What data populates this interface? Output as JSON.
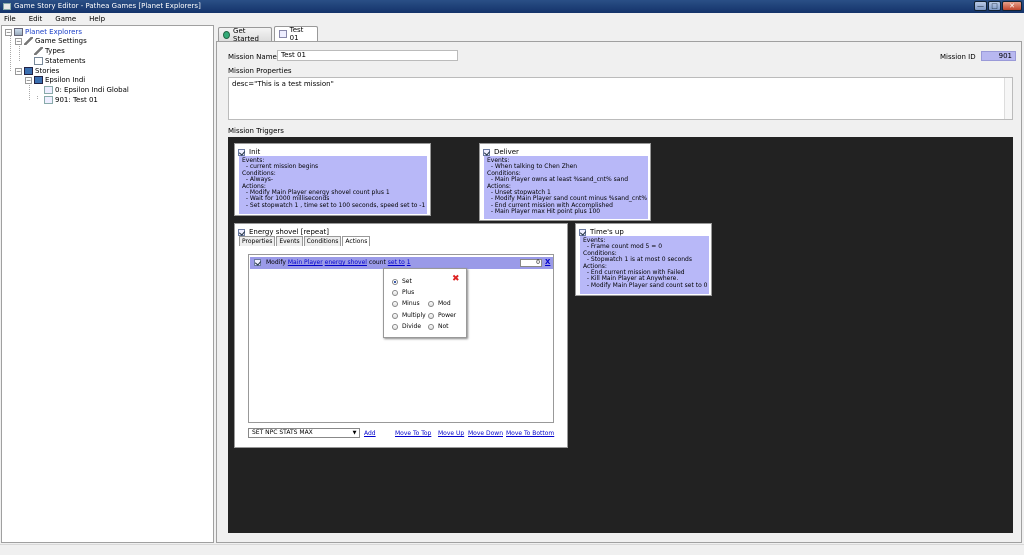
{
  "window": {
    "title": "Game Story Editor - Pathea Games  [Planet Explorers]",
    "min": "—",
    "max": "□",
    "close": "✕"
  },
  "menu": [
    "File",
    "Edit",
    "Game",
    "Help"
  ],
  "tree": {
    "root": "Planet Explorers",
    "game_settings": "Game Settings",
    "types": "Types",
    "statements": "Statements",
    "stories": "Stories",
    "epsilon": "Epsilon Indi",
    "global": "0: Epsilon Indi Global",
    "test": "901: Test 01"
  },
  "tabs": [
    {
      "label": "Get Started"
    },
    {
      "label": "Test 01"
    }
  ],
  "mission": {
    "name_label": "Mission Name",
    "name": "Test 01",
    "id_label": "Mission ID",
    "id": "901",
    "props_label": "Mission Properties",
    "props": "desc=\"This is a test mission\"",
    "triggers_label": "Mission Triggers"
  },
  "triggers": {
    "init": {
      "title": "Init",
      "body": "Events:\n  - current mission begins\nConditions:\n  - Always-\nActions:\n  - Modify Main Player energy shovel count plus 1\n  - Wait for 1000 milliseconds\n  - Set stopwatch 1 , time set to 100 seconds, speed set to -1"
    },
    "deliver": {
      "title": "Deliver",
      "body": "Events:\n  - When talking to Chen Zhen\nConditions:\n  - Main Player owns at least %sand_cnt% sand\nActions:\n  - Unset stopwatch 1\n  - Modify Main Player sand count minus %sand_cnt%\n  - End current mission with Accomplished\n  - Main Player max Hit point plus 100"
    },
    "timesup": {
      "title": "Time's up",
      "body": "Events:\n  - Frame count mod 5 = 0\nConditions:\n  - Stopwatch 1 is at most 0 seconds\nActions:\n  - End current mission with Failed\n  - Kill Main Player at Anywhere.\n  - Modify Main Player sand count set to 0"
    },
    "energy": {
      "title": "Energy shovel [repeat]",
      "subtabs": [
        "Properties",
        "Events",
        "Conditions",
        "Actions"
      ]
    }
  },
  "action": {
    "prefix": "Modify",
    "player": "Main Player",
    "item": "energy shovel",
    "mid": "count",
    "op": "set to",
    "val": "1",
    "num": "0",
    "x": "X"
  },
  "operators": [
    "Set",
    "Plus",
    "Minus",
    "Mod",
    "Multiply",
    "Power",
    "Divide",
    "Not"
  ],
  "bottom": {
    "select": "SET NPC STATS MAX",
    "add": "Add",
    "top": "Move To Top",
    "up": "Move Up",
    "down": "Move Down",
    "bottom": "Move To Bottom"
  }
}
